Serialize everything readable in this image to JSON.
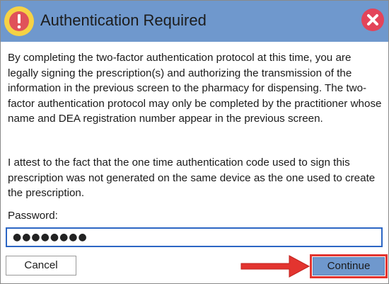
{
  "dialog": {
    "title": "Authentication Required",
    "title_icon": "exclamation-icon",
    "close_icon": "close-icon"
  },
  "body": {
    "paragraph1": "By completing the two-factor authentication protocol at this time, you are legally signing the prescription(s) and authorizing the transmission of the information in the previous screen to the pharmacy for dispensing. The two-factor authentication protocol may only be completed by the practitioner whose name and DEA registration number appear in the previous screen.",
    "paragraph2": "I attest to the fact that the one time authentication code used to sign this prescription was not generated on the same device as the one used to create the prescription."
  },
  "password": {
    "label": "Password:",
    "value": "●●●●●●●●"
  },
  "buttons": {
    "cancel": "Cancel",
    "continue": "Continue"
  },
  "colors": {
    "titlebar": "#6f98cd",
    "highlight": "#e3342f",
    "input_border": "#2c66c4"
  }
}
